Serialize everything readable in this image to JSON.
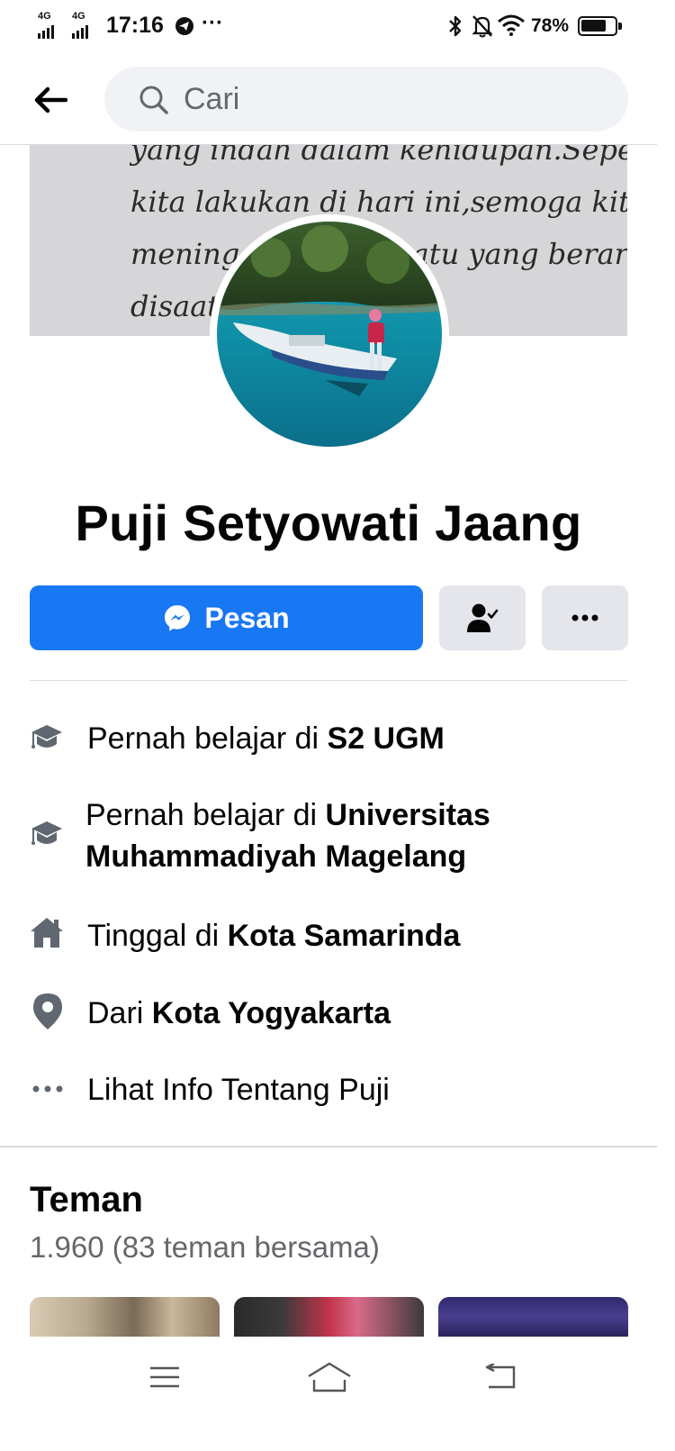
{
  "status_bar": {
    "signal_1": "4G",
    "signal_2": "4G",
    "time": "17:16",
    "overflow": "···",
    "battery_pct": "78%",
    "battery_level": 0.78,
    "icons": [
      "signal-icon",
      "telegram-icon",
      "bluetooth-icon",
      "mute-bell-icon",
      "wifi-icon",
      "battery-icon"
    ]
  },
  "header": {
    "back_icon": "back-arrow-icon",
    "search_placeholder": "Cari"
  },
  "cover": {
    "lines": [
      "yang indah dalam kehidupan.Seperti yang",
      "kita lakukan di hari ini,semoga kita dapat",
      "meninggalkan sesuatu yang berarti",
      "disaat"
    ]
  },
  "profile": {
    "name": "Puji Setyowati Jaang",
    "message_label": "Pesan",
    "friend_icon": "friend-status-icon",
    "more_icon": "more-dots-icon"
  },
  "details": [
    {
      "icon": "graduation-cap-icon",
      "prefix": "Pernah belajar di ",
      "bold": "S2 UGM"
    },
    {
      "icon": "graduation-cap-icon",
      "prefix": "Pernah belajar di ",
      "bold": "Universitas Muhammadiyah Magelang"
    },
    {
      "icon": "home-icon",
      "prefix": "Tinggal di ",
      "bold": "Kota Samarinda"
    },
    {
      "icon": "location-pin-icon",
      "prefix": "Dari ",
      "bold": "Kota Yogyakarta"
    },
    {
      "icon": "more-dots-icon",
      "prefix": "Lihat Info Tentang Puji",
      "bold": ""
    }
  ],
  "friends": {
    "title": "Teman",
    "count_text": "1.960 (83 teman bersama)"
  },
  "navbar": {
    "icons": [
      "menu-icon",
      "home-outline-icon",
      "back-nav-icon"
    ]
  },
  "colors": {
    "accent": "#1877f2",
    "secondary_button": "#e4e6eb",
    "search_bg": "#f0f2f5",
    "muted_text": "#65676b",
    "icon_gray": "#606770"
  }
}
